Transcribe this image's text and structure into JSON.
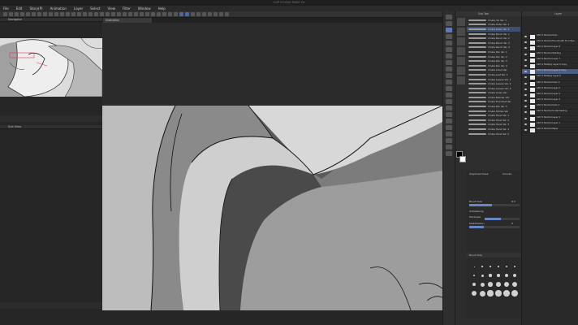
{
  "window": {
    "title": "CLIP STUDIO PAINT EX"
  },
  "menu": [
    "File",
    "Edit",
    "Story(P)",
    "Animation",
    "Layer",
    "Select",
    "View",
    "Filter",
    "Window",
    "Help"
  ],
  "navigator": {
    "title": "Navigator"
  },
  "sub_view": {
    "title": "Sub View"
  },
  "canvas": {
    "tab_label": "Illustration"
  },
  "sub_tool": {
    "title": "Sub Tool",
    "brushes": [
      {
        "name": "Chuba Ink Ver. 1"
      },
      {
        "name": "Chuba Outer Var. 1"
      },
      {
        "name": "Chuba Outer Var. 2"
      },
      {
        "name": "Chuba Pencil Var. 1"
      },
      {
        "name": "Chuba Pencil Var. 2"
      },
      {
        "name": "Chuba Pencil Var. 3"
      },
      {
        "name": "Chuba Pencil Var. 4"
      },
      {
        "name": "Chuba Pen Var. 1"
      },
      {
        "name": "Chuba Pen Var. 2"
      },
      {
        "name": "Chuba Pen Var. 3"
      },
      {
        "name": "Chuba Pen Var. 4"
      },
      {
        "name": "Chuba Cloud Var."
      },
      {
        "name": "Chuba Leaf Var. 1"
      },
      {
        "name": "Chuba Leaves Var. 1"
      },
      {
        "name": "Chuba Leaves Var. 2"
      },
      {
        "name": "Chuba Leaves Var. 3"
      },
      {
        "name": "Chuba Grass Var."
      },
      {
        "name": "Chuba Blender Var."
      },
      {
        "name": "Chuba Fine Dust Var."
      },
      {
        "name": "Chuba Pen Var. 5"
      },
      {
        "name": "Chuba Smoke Var."
      },
      {
        "name": "Chuba Hand Var. 1"
      },
      {
        "name": "Chuba Hand Var. 2"
      },
      {
        "name": "Chuba Hand Var. 3"
      },
      {
        "name": "Chuba Hand Var. 4"
      },
      {
        "name": "Chuba Hand Var. 5"
      }
    ]
  },
  "tool_property": {
    "brush_name": "Alignment base",
    "canvas_label": "Canvas",
    "brush_size_label": "Brush Size",
    "brush_size_value": "8.0",
    "antialiasing_label": "Antialiasing",
    "hardness_label": "Hardness",
    "stabilization_label": "Stabilization",
    "stabilization_value": "9"
  },
  "brush_size_palette": {
    "title": "Brush Size"
  },
  "layers": {
    "title": "Layer",
    "items": [
      {
        "label": "100 % Normal Outl..."
      },
      {
        "label": "100 % Normal the smooth 10 A Bya"
      },
      {
        "label": "100 % Normal Layer 8"
      },
      {
        "label": "100 % Normal Shading"
      },
      {
        "label": "100 % Normal Layer 7"
      },
      {
        "label": "100 % Multiply Layer 6 Copy"
      },
      {
        "label": "100 % Normal Layer 6 Copy"
      },
      {
        "label": "100 % Multiply Layer 6"
      },
      {
        "label": "100 % Normal Color 2"
      },
      {
        "label": "100 % Normal Layer 5"
      },
      {
        "label": "100 % Normal Layer 4"
      },
      {
        "label": "100 % Normal Layer 3"
      },
      {
        "label": "100 % Normal Color 1"
      },
      {
        "label": "100 % Normal Underdrawing"
      },
      {
        "label": "100 % Normal Layer 2"
      },
      {
        "label": "100 % Normal Layer 1"
      },
      {
        "label": "100 % Normal Paper"
      }
    ],
    "selected_index": 6
  },
  "colors": {
    "accent": "#4a5d86",
    "main_color": "#000000",
    "sub_color": "#ffffff"
  }
}
